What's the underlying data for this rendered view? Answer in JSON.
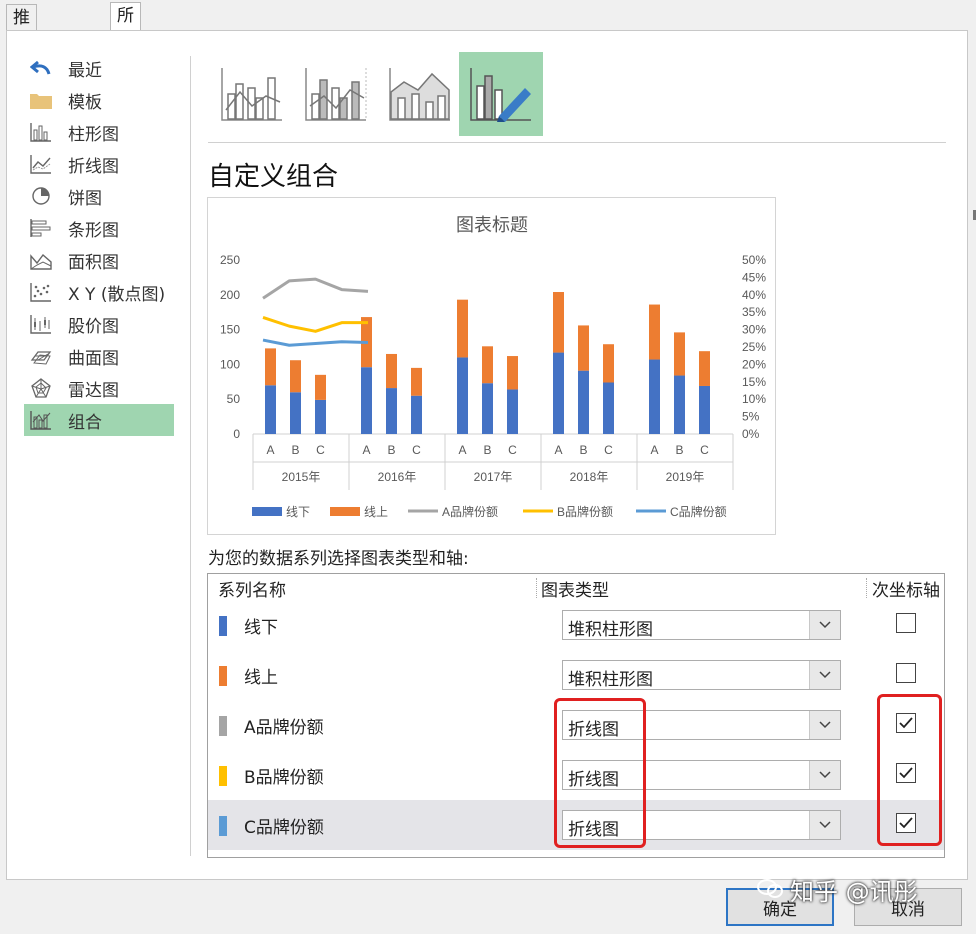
{
  "tabs": [
    "推荐的图表",
    "所有图表"
  ],
  "sidebar": {
    "items": [
      {
        "label": "最近",
        "icon": "undo-icon"
      },
      {
        "label": "模板",
        "icon": "folder-icon"
      },
      {
        "label": "柱形图",
        "icon": "column-chart-icon"
      },
      {
        "label": "折线图",
        "icon": "line-chart-icon"
      },
      {
        "label": "饼图",
        "icon": "pie-chart-icon"
      },
      {
        "label": "条形图",
        "icon": "bar-chart-icon"
      },
      {
        "label": "面积图",
        "icon": "area-chart-icon"
      },
      {
        "label": "X Y (散点图)",
        "icon": "scatter-chart-icon"
      },
      {
        "label": "股价图",
        "icon": "stock-chart-icon"
      },
      {
        "label": "曲面图",
        "icon": "surface-chart-icon"
      },
      {
        "label": "雷达图",
        "icon": "radar-chart-icon"
      },
      {
        "label": "组合",
        "icon": "combo-chart-icon"
      }
    ],
    "selected_index": 11
  },
  "subtypes": [
    "clustered-column-line-icon",
    "clustered-column-line-secondary-icon",
    "stacked-area-column-icon",
    "custom-combo-icon"
  ],
  "heading": "自定义组合",
  "chart_data": {
    "type": "bar",
    "title": "图表标题",
    "groups": [
      "2015年",
      "2016年",
      "2017年",
      "2018年",
      "2019年"
    ],
    "categories": [
      "A",
      "B",
      "C"
    ],
    "ylim": [
      0,
      250
    ],
    "yticks": [
      "250",
      "200",
      "150",
      "100",
      "50",
      "0"
    ],
    "y2lim": [
      0,
      0.5
    ],
    "y2ticks": [
      "50%",
      "45%",
      "40%",
      "35%",
      "30%",
      "25%",
      "20%",
      "15%",
      "10%",
      "5%",
      "0%"
    ],
    "stacked_series": [
      {
        "name": "线下",
        "color": "#4472c4",
        "values": [
          70,
          60,
          49,
          96,
          66,
          55,
          110,
          73,
          64,
          117,
          91,
          74,
          107,
          84,
          69
        ]
      },
      {
        "name": "线上",
        "color": "#ed7d31",
        "values": [
          53,
          46,
          36,
          72,
          49,
          40,
          83,
          53,
          48,
          87,
          65,
          55,
          79,
          62,
          50
        ]
      }
    ],
    "line_series": [
      {
        "name": "A品牌份额",
        "color": "#a5a5a5",
        "x": [
          0,
          1,
          2,
          3,
          4
        ],
        "values": [
          0.39,
          0.44,
          0.445,
          0.415,
          0.41
        ]
      },
      {
        "name": "B品牌份额",
        "color": "#ffc000",
        "x": [
          0,
          1,
          2,
          3,
          4
        ],
        "values": [
          0.335,
          0.31,
          0.295,
          0.32,
          0.32
        ]
      },
      {
        "name": "C品牌份额",
        "color": "#5b9bd5",
        "x": [
          0,
          1,
          2,
          3,
          4
        ],
        "values": [
          0.27,
          0.255,
          0.26,
          0.265,
          0.263
        ]
      }
    ],
    "legend_position": "bottom"
  },
  "instruction": "为您的数据系列选择图表类型和轴:",
  "table": {
    "headers": [
      "系列名称",
      "图表类型",
      "次坐标轴"
    ],
    "rows": [
      {
        "name": "线下",
        "color": "#4472c4",
        "type": "堆积柱形图",
        "secondary": false
      },
      {
        "name": "线上",
        "color": "#ed7d31",
        "type": "堆积柱形图",
        "secondary": false
      },
      {
        "name": "A品牌份额",
        "color": "#a5a5a5",
        "type": "折线图",
        "secondary": true
      },
      {
        "name": "B品牌份额",
        "color": "#ffc000",
        "type": "折线图",
        "secondary": true
      },
      {
        "name": "C品牌份额",
        "color": "#5b9bd5",
        "type": "折线图",
        "secondary": true
      }
    ],
    "highlight_index": 4
  },
  "buttons": {
    "ok": "确定",
    "cancel": "取消"
  },
  "watermark": "知乎 @讯彤"
}
